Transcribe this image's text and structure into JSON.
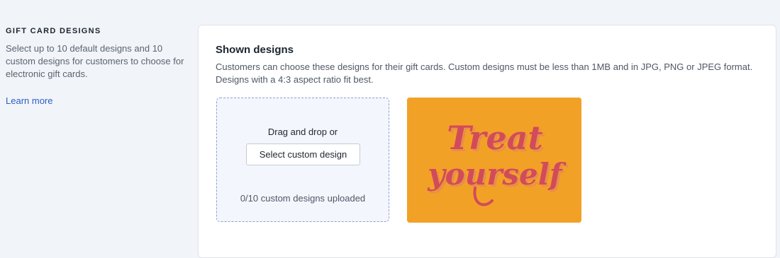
{
  "section": {
    "heading": "GIFT CARD DESIGNS",
    "description": "Select up to 10 default designs and 10 custom designs for customers to choose for electronic gift cards.",
    "learn_more": "Learn more"
  },
  "card": {
    "title": "Shown designs",
    "description": "Customers can choose these designs for their gift cards. Custom designs must be less than 1MB and in JPG, PNG or JPEG format. Designs with a 4:3 aspect ratio fit best.",
    "dropzone": {
      "prompt": "Drag and drop or",
      "button_label": "Select custom design",
      "count_text": "0/10 custom designs uploaded"
    },
    "designs": [
      {
        "text_line_1": "Treat",
        "text_line_2": "yourself",
        "background": "#f2a127",
        "lettering_color": "#d24b5a"
      }
    ]
  },
  "colors": {
    "page_bg": "#f1f4f8",
    "card_bg": "#ffffff",
    "link": "#2a5fc4",
    "dropzone_border": "#8aa0d6"
  }
}
